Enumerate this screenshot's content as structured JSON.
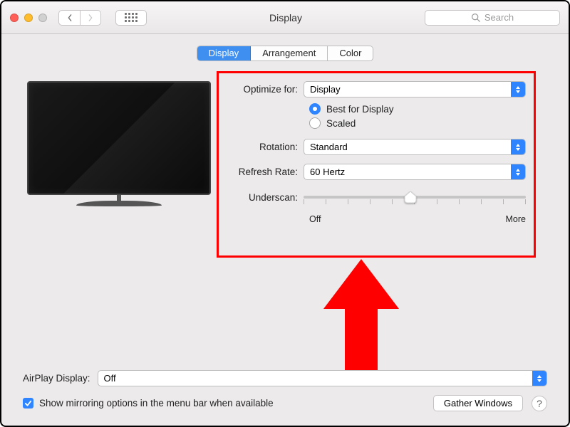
{
  "window": {
    "title": "Display"
  },
  "search": {
    "placeholder": "Search"
  },
  "tabs": {
    "display": "Display",
    "arrangement": "Arrangement",
    "color": "Color",
    "active": "display"
  },
  "settings": {
    "optimizeFor": {
      "label": "Optimize for:",
      "value": "Display"
    },
    "resolutionMode": {
      "best": "Best for Display",
      "scaled": "Scaled",
      "selected": "best"
    },
    "rotation": {
      "label": "Rotation:",
      "value": "Standard"
    },
    "refreshRate": {
      "label": "Refresh Rate:",
      "value": "60 Hertz"
    },
    "underscan": {
      "label": "Underscan:",
      "offLabel": "Off",
      "moreLabel": "More",
      "valuePercent": 48
    }
  },
  "airplay": {
    "label": "AirPlay Display:",
    "value": "Off"
  },
  "mirroring": {
    "label": "Show mirroring options in the menu bar when available",
    "checked": true
  },
  "buttons": {
    "gatherWindows": "Gather Windows",
    "help": "?"
  },
  "colors": {
    "accent": "#2f84ff",
    "annotation": "#ff0000"
  }
}
